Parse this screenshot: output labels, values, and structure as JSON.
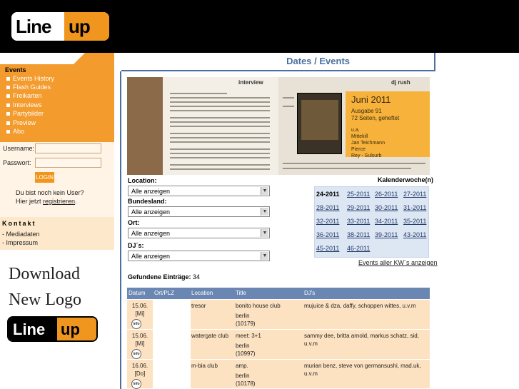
{
  "header": {
    "logo_line": "Line",
    "logo_up": "up",
    "page_title": "Dates / Events"
  },
  "sidebar": {
    "section_title": "Events",
    "items": [
      {
        "label": "Events History"
      },
      {
        "label": "Flash Guides"
      },
      {
        "label": "Freikarten"
      },
      {
        "label": "Interviews"
      },
      {
        "label": "Partybilder"
      },
      {
        "label": "Preview"
      },
      {
        "label": "Abo"
      }
    ],
    "login": {
      "username_label": "Username:",
      "password_label": "Passwort:",
      "username_value": "",
      "password_value": "",
      "button": "LOGIN",
      "register_line1": "Du bist noch kein User?",
      "register_prefix": "Hier jetzt ",
      "register_link": "registrieren",
      "register_suffix": "."
    },
    "kontakt": {
      "title": "Kontakt",
      "items": [
        {
          "label": "- Mediadaten"
        },
        {
          "label": "- Impressum"
        }
      ]
    },
    "download_line1": "Download",
    "download_line2": "New Logo",
    "logo_line": "Line",
    "logo_up": "up"
  },
  "banner": {
    "interview_heading": "interview",
    "right_heading": "dj rush",
    "ad_title": "Juni 2011",
    "ad_sub1": "Ausgabe 91",
    "ad_sub2": "72 Seiten, geheftet",
    "ad_names": [
      "u.a.",
      "Mittekill",
      "Jan Teichmann",
      "Pierce",
      "Rey - Sulsurb"
    ]
  },
  "filters": {
    "location_label": "Location:",
    "location_value": "Alle anzeigen",
    "bundesland_label": "Bundesland:",
    "bundesland_value": "Alle anzeigen",
    "ort_label": "Ort:",
    "ort_value": "Alle anzeigen",
    "djs_label": "DJ´s:",
    "djs_value": "Alle anzeigen"
  },
  "calendar": {
    "title": "Kalenderwoche(n)",
    "weeks": [
      "24-2011",
      "25-2011",
      "26-2011",
      "27-2011",
      "28-2011",
      "29-2011",
      "30-2011",
      "31-2011",
      "32-2011",
      "33-2011",
      "34-2011",
      "35-2011",
      "36-2011",
      "38-2011",
      "39-2011",
      "43-2011",
      "45-2011",
      "46-2011"
    ],
    "current": "24-2011",
    "all_link": "Events aller KW´s anzeigen"
  },
  "results": {
    "label": "Gefundene Einträge:",
    "count": "34"
  },
  "table": {
    "headers": [
      "Datum",
      "Ort/PLZ",
      "Location",
      "Title",
      "DJ's"
    ],
    "rows": [
      {
        "date": "15.06.",
        "day": "[Mi]",
        "location": "tresor",
        "title": "bonito house club",
        "city": "berlin",
        "plz": "(10179)",
        "djs": "mujuice & dza, daffy, schoppen wittes, u.v.m"
      },
      {
        "date": "15.06.",
        "day": "[Mi]",
        "location": "watergate club",
        "title": "meet: 3+1",
        "city": "berlin",
        "plz": "(10997)",
        "djs": "sammy dee, britta arnold, markus schatz, sid, u.v.m"
      },
      {
        "date": "16.06.",
        "day": "[Do]",
        "location": "m-bia club",
        "title": "amp.",
        "city": "berlin",
        "plz": "(10178)",
        "djs": "murian benz, steve von germansushi, mad.uk, u.v.m"
      }
    ],
    "info_label": "info"
  },
  "colors": {
    "orange": "#f39b2d",
    "blue": "#4a6fa0",
    "table_header": "#6a86b3",
    "row_bg": "#fde2c2"
  }
}
